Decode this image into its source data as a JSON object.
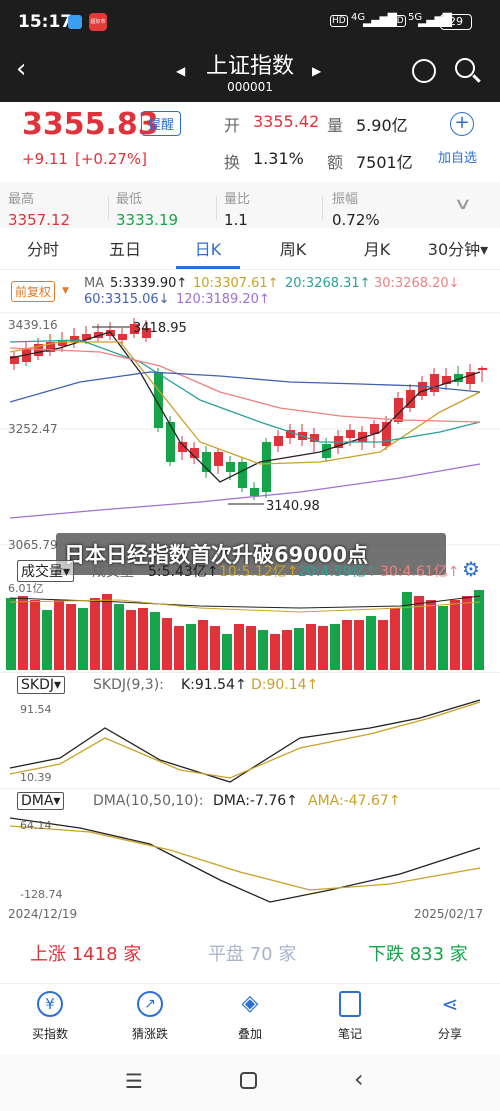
{
  "status": {
    "time": "15:17",
    "app_badge": "超好市",
    "network": "4G",
    "network2": "5G",
    "battery": "29"
  },
  "nav": {
    "title": "上证指数",
    "code": "000001"
  },
  "quote": {
    "price": "3355.83",
    "alert_label": "提醒",
    "change": "+9.11",
    "change_pct": "[+0.27%]",
    "open_label": "开",
    "open": "3355.42",
    "volume_label": "量",
    "volume": "5.90亿",
    "turnover_label": "换",
    "turnover": "1.31%",
    "amount_label": "额",
    "amount": "7501亿",
    "add_watch_label": "加自选"
  },
  "stats": [
    {
      "label": "最高",
      "value": "3357.12"
    },
    {
      "label": "最低",
      "value": "3333.19"
    },
    {
      "label": "量比",
      "value": "1.1"
    },
    {
      "label": "振幅",
      "value": "0.72%"
    }
  ],
  "tabs": [
    {
      "label": "分时"
    },
    {
      "label": "五日"
    },
    {
      "label": "日K"
    },
    {
      "label": "周K"
    },
    {
      "label": "月K"
    },
    {
      "label": "30分钟▾"
    }
  ],
  "ma": {
    "adjust_label": "前复权",
    "title": "MA",
    "ma5": "5:3339.90↑",
    "ma10": "10:3307.61↑",
    "ma20": "20:3268.31↑",
    "ma30": "30:3268.20↓",
    "ma60": "60:3315.06↓",
    "ma120": "120:3189.20↑",
    "y_top": "3439.16",
    "y_mid": "3252.47",
    "y_bottom": "3065.79",
    "high_label": "3418.95",
    "low_label": "3140.98"
  },
  "volume_panel": {
    "selector": "成交量▾",
    "title": "成交量",
    "v5": "5:5.43亿↑",
    "v10": "10:5.12亿↑",
    "v20": "20:4.59亿↑",
    "v30": "30:4.61亿↑",
    "y_top": "6.01亿"
  },
  "overlay_headline": "日本日经指数首次升破69000点",
  "skdj": {
    "selector": "SKDJ▾",
    "params": "SKDJ(9,3):",
    "k": "K:91.54↑",
    "d": "D:90.14↑",
    "y_top": "91.54",
    "y_bottom": "10.39"
  },
  "dma": {
    "selector": "DMA▾",
    "params": "DMA(10,50,10):",
    "dma": "DMA:-7.76↑",
    "ama": "AMA:-47.67↑",
    "y_top": "64.14",
    "y_bottom": "-128.74"
  },
  "dates": {
    "start": "2024/12/19",
    "end": "2025/02/17"
  },
  "breadth": {
    "up": "上涨 1418 家",
    "flat": "平盘 70 家",
    "down": "下跌 833 家"
  },
  "bottom_nav": [
    {
      "label": "买指数",
      "icon": "yen-icon"
    },
    {
      "label": "猜涨跌",
      "icon": "guess-icon"
    },
    {
      "label": "叠加",
      "icon": "layers-icon"
    },
    {
      "label": "笔记",
      "icon": "note-icon"
    },
    {
      "label": "分享",
      "icon": "share-icon"
    }
  ],
  "colors": {
    "up": "#e0323b",
    "down": "#17a34a",
    "ma5": "#222222",
    "ma10": "#c9a227",
    "ma20": "#2aa198",
    "ma30": "#f08080",
    "ma60": "#4060b0",
    "ma120": "#a070d0"
  }
}
